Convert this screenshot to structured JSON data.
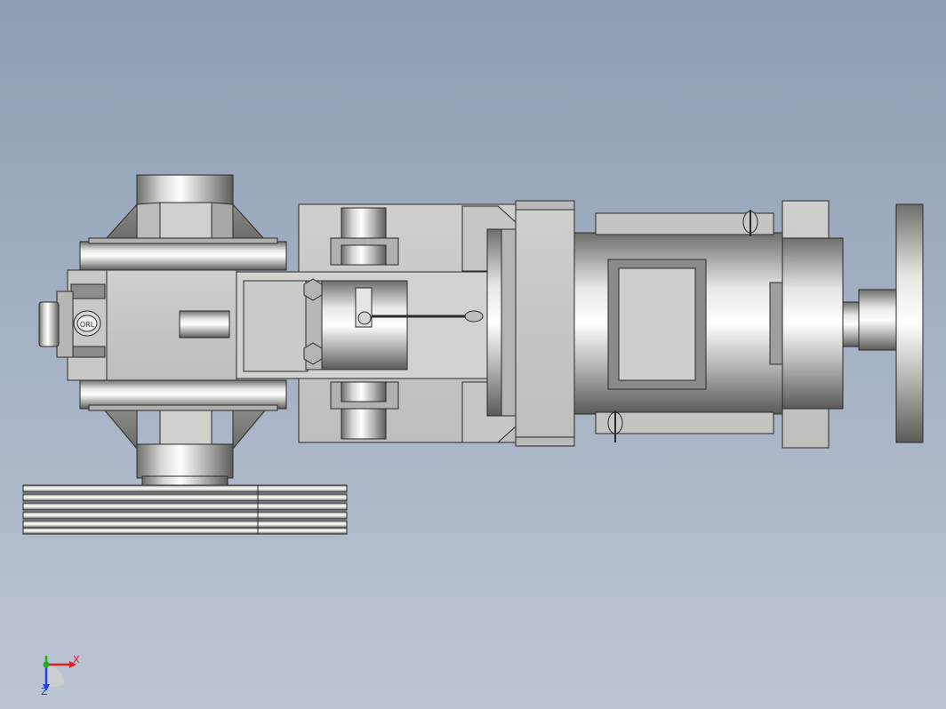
{
  "viewport": {
    "background_top": "#8e9db4",
    "background_bottom": "#bcc5d2"
  },
  "model": {
    "nameplate_text": "ORL",
    "part_color": "#c4c4c1",
    "edge_color": "#2a2a2a"
  },
  "triad": {
    "x_label": "X",
    "y_label": "Y",
    "z_label": "Z",
    "x_color": "#e02020",
    "y_color": "#20b020",
    "z_color": "#2040e0"
  }
}
